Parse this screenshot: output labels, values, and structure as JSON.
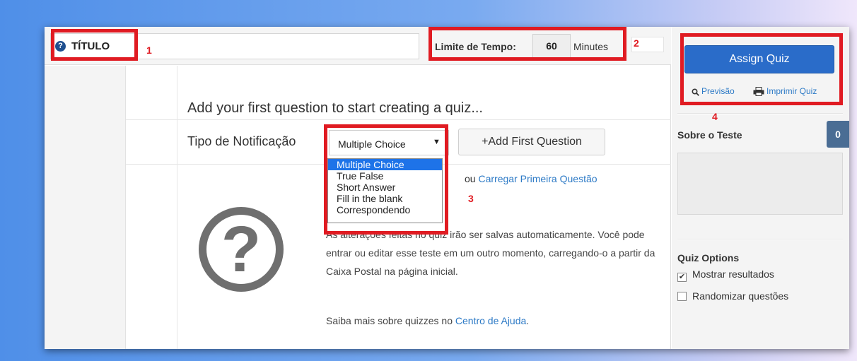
{
  "header": {
    "title": "TÍTULO",
    "time_limit_label": "Limite de Tempo:",
    "time_limit_value": "60",
    "time_unit": "Minutes"
  },
  "main": {
    "heading": "Add your first question to start creating a quiz...",
    "notification_label": "Tipo de Notificação",
    "question_type": {
      "selected": "Multiple Choice",
      "options": [
        "Multiple Choice",
        "True False",
        "Short Answer",
        "Fill in the blank",
        "Correspondendo"
      ]
    },
    "add_button": "+Add First Question",
    "or_text": "ou ",
    "upload_link": "Carregar Primeira Questão",
    "autosave_text": "As alterações feitas no quiz irão ser salvas automaticamente. Você pode entrar ou editar esse teste em um outro momento, carregando-o a partir da Caixa Postal na página inicial.",
    "help_text": "Saiba mais sobre quizzes no ",
    "help_link": "Centro de Ajuda",
    "help_suffix": "."
  },
  "sidebar": {
    "assign_button": "Assign Quiz",
    "preview_link": "Previsão",
    "print_link": "Imprimir Quiz",
    "about_title": "Sobre o Teste",
    "question_count": "0",
    "options_title": "Quiz Options",
    "options": [
      {
        "label": "Mostrar resultados",
        "checked": true
      },
      {
        "label": "Randomizar questões",
        "checked": false
      }
    ]
  },
  "annotations": [
    "1",
    "2",
    "3",
    "4"
  ],
  "colors": {
    "highlight": "#e01b22",
    "primary_button": "#2a6cc9",
    "link": "#2d7ac6",
    "dropdown_selected": "#1e73e8"
  }
}
